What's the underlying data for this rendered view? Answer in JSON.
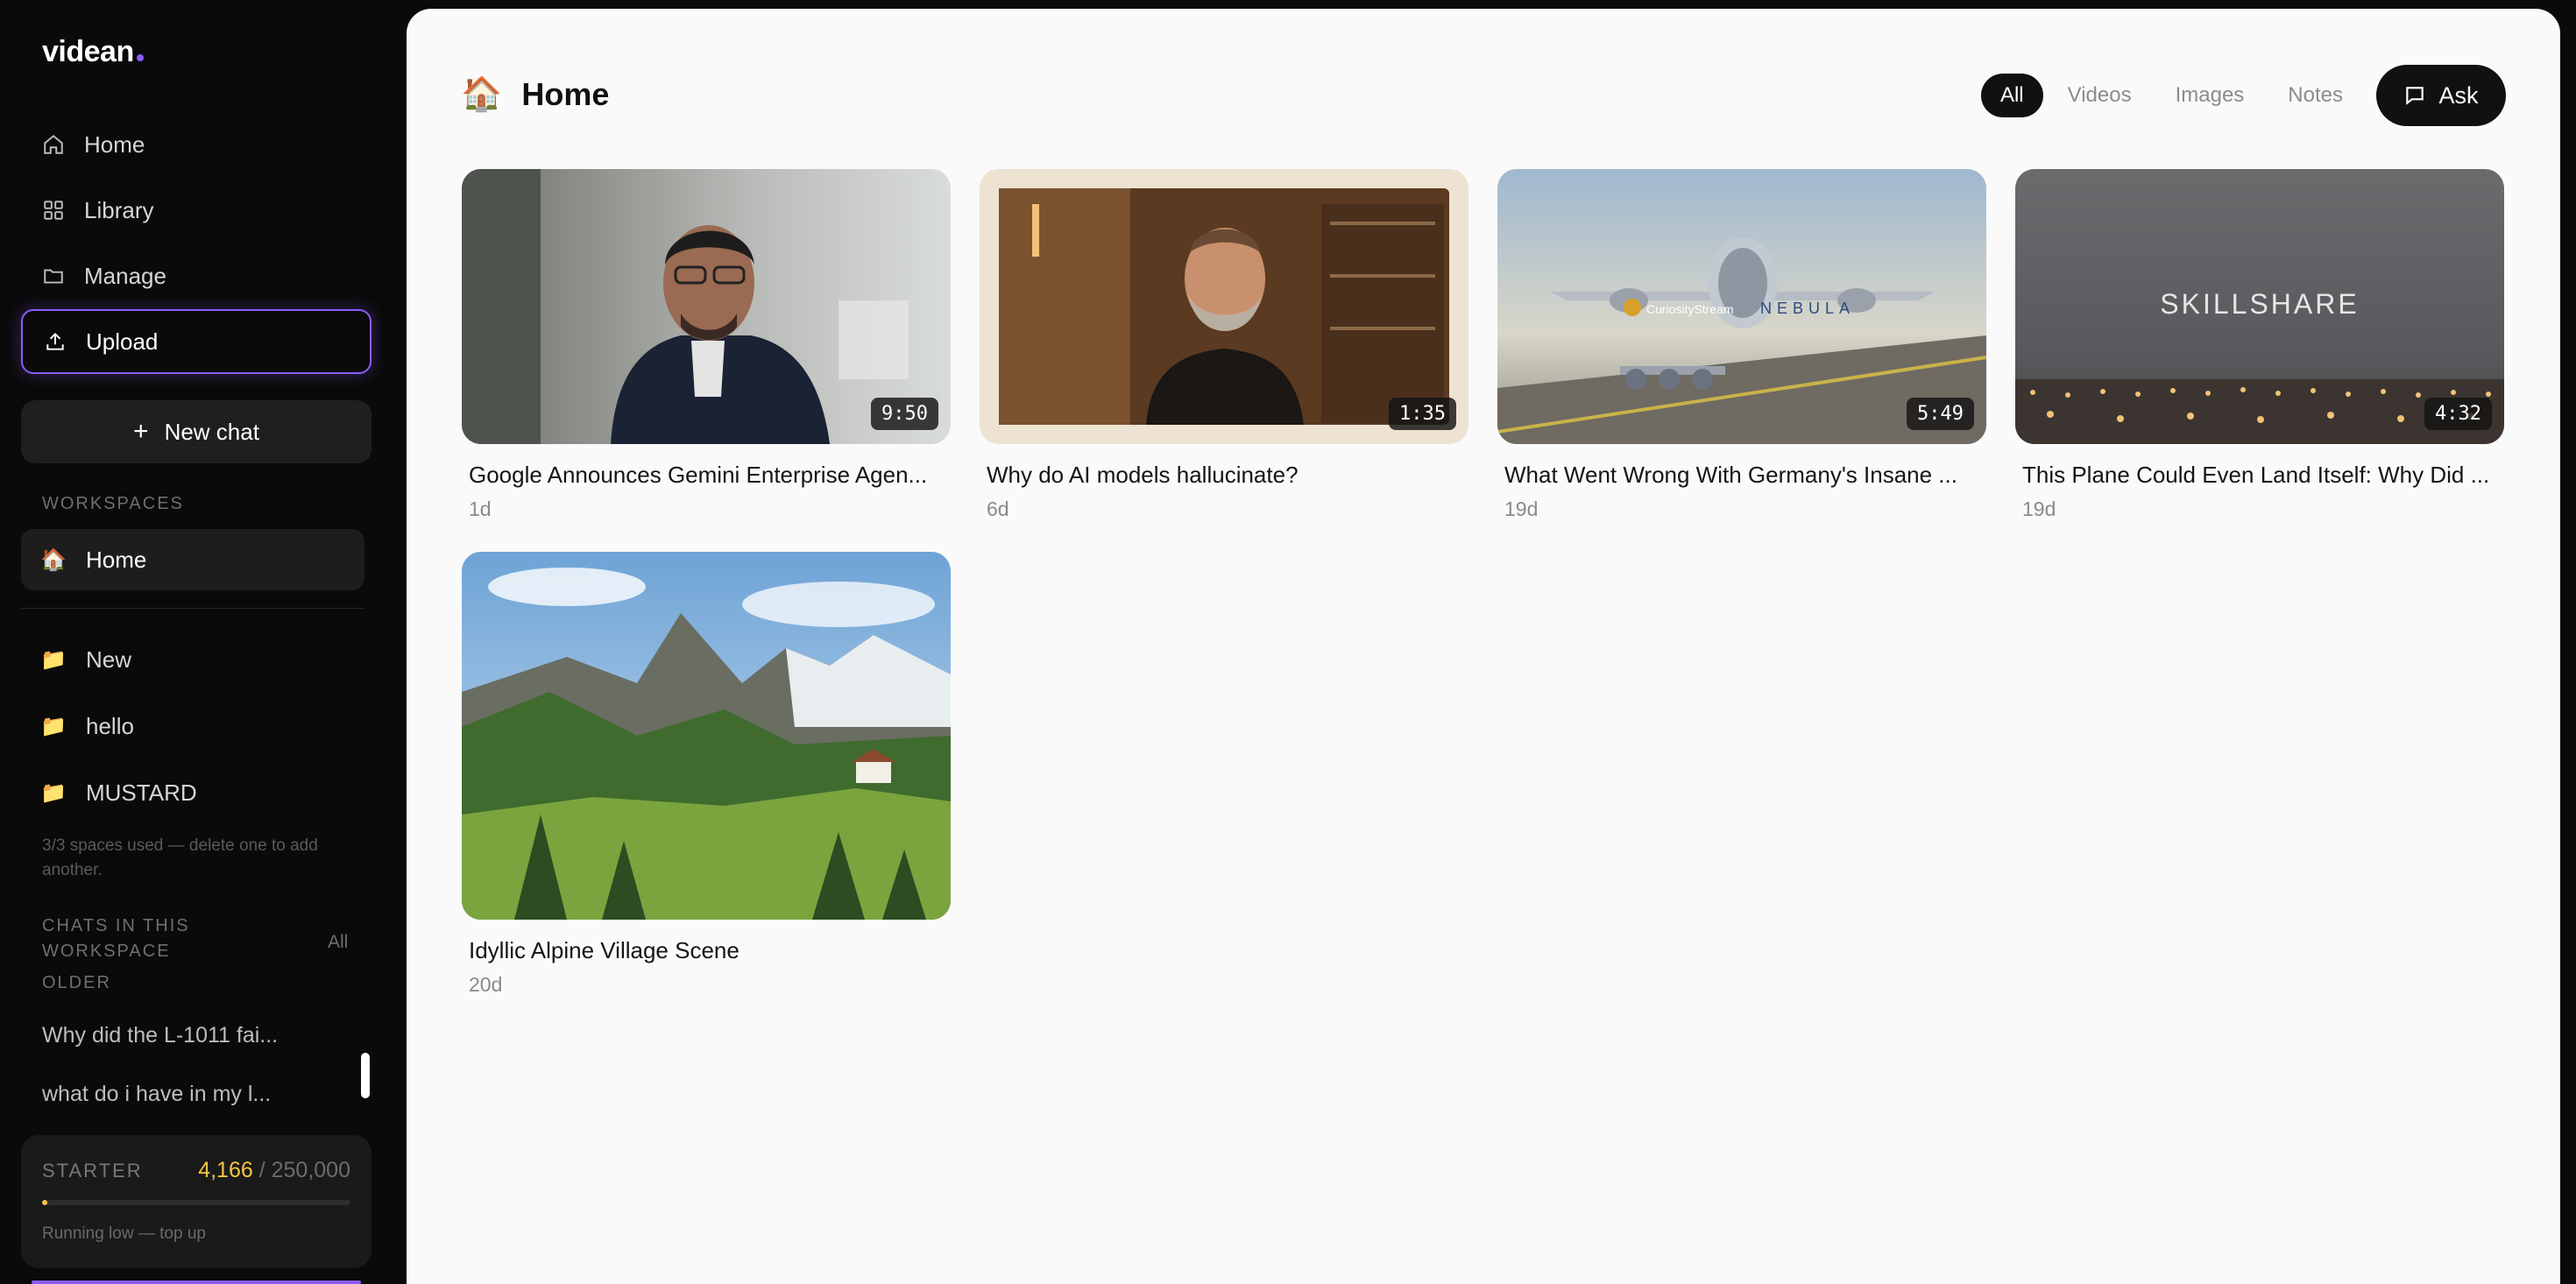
{
  "app": {
    "name": "videan"
  },
  "sidebar": {
    "nav": [
      {
        "label": "Home",
        "icon": "home-icon"
      },
      {
        "label": "Library",
        "icon": "grid-icon"
      },
      {
        "label": "Manage",
        "icon": "folder-icon"
      },
      {
        "label": "Upload",
        "icon": "upload-icon"
      }
    ],
    "new_chat": {
      "label": "New chat",
      "icon": "plus-icon"
    },
    "workspaces_label": "WORKSPACES",
    "workspaces": [
      {
        "label": "Home",
        "emoji": "🏠",
        "active": true
      },
      {
        "label": "New",
        "emoji": "📁"
      },
      {
        "label": "hello",
        "emoji": "📁"
      },
      {
        "label": "MUSTARD",
        "emoji": "📁"
      }
    ],
    "spaces_hint": "3/3 spaces used — delete one to add another.",
    "chats_label_line1": "CHATS IN THIS",
    "chats_label_line2": "WORKSPACE",
    "chats_all": "All",
    "older_label": "OLDER",
    "chats": [
      {
        "label": "Why did the L-1011 fai..."
      },
      {
        "label": "what do i have in my l..."
      }
    ],
    "credits": {
      "plan": "STARTER",
      "used": "4,166",
      "separator": "/",
      "total": "250,000",
      "fraction": 0.0167,
      "status": "Running low — top up",
      "accent": "#f5c542"
    }
  },
  "main": {
    "title": "Home",
    "title_emoji": "🏠",
    "filters": [
      {
        "label": "All",
        "active": true
      },
      {
        "label": "Videos"
      },
      {
        "label": "Images"
      },
      {
        "label": "Notes"
      }
    ],
    "ask": {
      "label": "Ask",
      "icon": "chat-bubble-icon"
    },
    "items": [
      {
        "title": "Google Announces Gemini Enterprise Agen...",
        "age": "1d",
        "duration": "9:50",
        "thumb": "office-interview"
      },
      {
        "title": "Why do AI models hallucinate?",
        "age": "6d",
        "duration": "1:35",
        "thumb": "bearded-speaker"
      },
      {
        "title": "What Went Wrong With Germany's Insane ...",
        "age": "19d",
        "duration": "5:49",
        "thumb": "aircraft-render",
        "thumb_text_a": "CuriosityStream",
        "thumb_text_b": "NEBULA"
      },
      {
        "title": "This Plane Could Even Land Itself: Why Did ...",
        "age": "19d",
        "duration": "4:32",
        "thumb": "skillshare-runway",
        "thumb_text": "SKILLSHARE"
      },
      {
        "title": "Idyllic Alpine Village Scene",
        "age": "20d",
        "thumb": "alpine-image"
      }
    ]
  },
  "colors": {
    "accent": "#8b5cf6",
    "sidebar_bg": "#0a0a0a",
    "main_bg": "#fafafa"
  }
}
